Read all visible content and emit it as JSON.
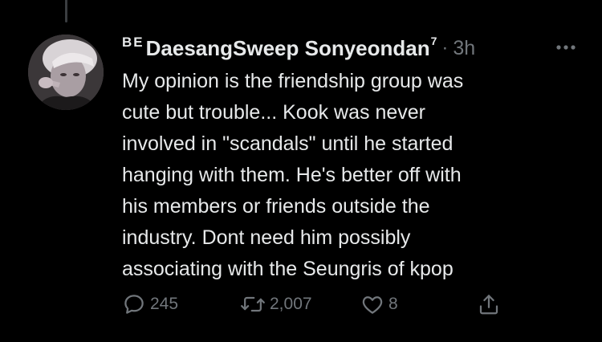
{
  "tweet": {
    "author": {
      "name_prefix": "BE",
      "display_name": "DaesangSweep Sonyeondan",
      "name_superscript": "7",
      "avatar": "avatar-photo"
    },
    "separator": "·",
    "timestamp": "3h",
    "text_lines": [
      "My opinion is the friendship group was",
      "cute but trouble... Kook was never",
      "involved in \"scandals\" until he started",
      "hanging with them. He's better off with",
      "his members or friends outside the",
      "industry. Dont need him possibly",
      "associating with the Seungris of kpop"
    ],
    "actions": {
      "reply_count": "245",
      "retweet_count": "2,007",
      "like_count": "8"
    }
  },
  "icons": {
    "more": "more-horizontal-icon",
    "reply": "reply-icon",
    "retweet": "retweet-icon",
    "like": "heart-icon",
    "share": "share-icon"
  },
  "colors": {
    "background": "#000000",
    "text": "#e7e9ea",
    "muted": "#71767b",
    "thread_line": "#3a3d40"
  }
}
